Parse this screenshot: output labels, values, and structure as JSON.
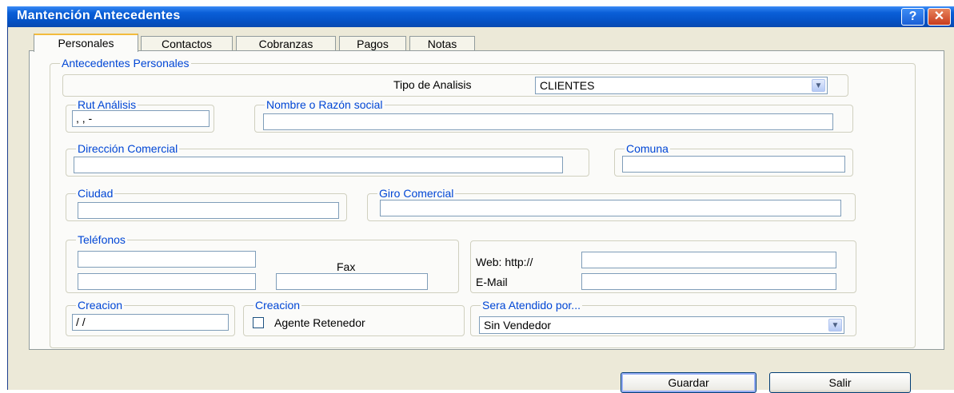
{
  "window": {
    "title": "Mantención Antecedentes",
    "help_glyph": "?",
    "close_glyph": "✕"
  },
  "tabs": [
    {
      "label": "Personales",
      "active": true
    },
    {
      "label": "Contactos"
    },
    {
      "label": "Cobranzas"
    },
    {
      "label": "Pagos"
    },
    {
      "label": "Notas"
    }
  ],
  "form": {
    "group_title": "Antecedentes Personales",
    "tipo_analisis": {
      "label": "Tipo de Analisis",
      "value": "CLIENTES"
    },
    "rut": {
      "legend": "Rut Análisis",
      "value": "  ,   ,   -"
    },
    "nombre": {
      "legend": "Nombre o Razón social",
      "value": ""
    },
    "direccion": {
      "legend": "Dirección Comercial",
      "value": ""
    },
    "comuna": {
      "legend": "Comuna",
      "value": ""
    },
    "ciudad": {
      "legend": "Ciudad",
      "value": ""
    },
    "giro": {
      "legend": "Giro Comercial",
      "value": ""
    },
    "telefonos": {
      "legend": "Teléfonos",
      "phone1": "",
      "phone2": "",
      "fax_label": "Fax",
      "fax": ""
    },
    "web": {
      "label": "Web: http://",
      "value": ""
    },
    "email": {
      "label": "E-Mail",
      "value": ""
    },
    "creacion": {
      "legend": "Creacion",
      "value": "  /  /"
    },
    "agente": {
      "legend": "Creacion",
      "label": "Agente Retenedor",
      "checked": false
    },
    "vendedor": {
      "legend": "Sera Atendido por...",
      "value": "Sin Vendedor"
    }
  },
  "buttons": {
    "guardar": "Guardar",
    "salir": "Salir"
  }
}
